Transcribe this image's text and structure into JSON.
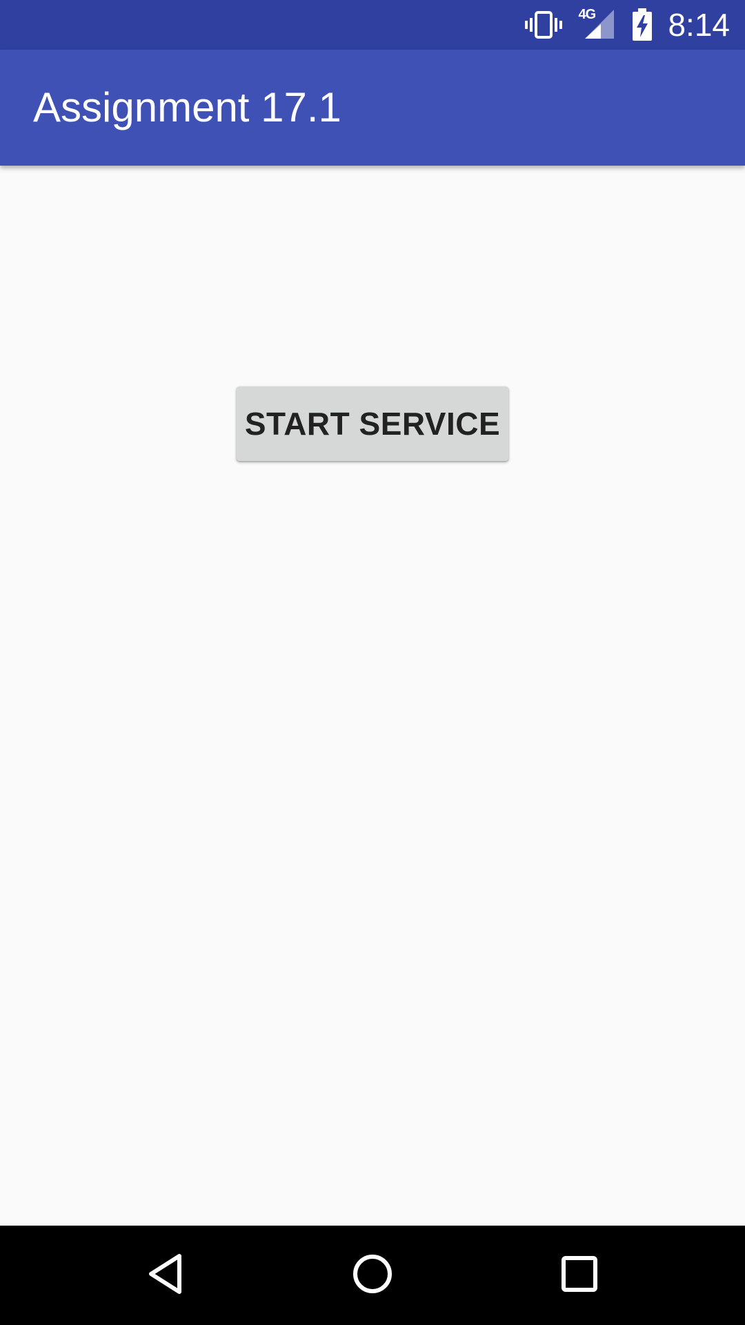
{
  "status_bar": {
    "time": "8:14",
    "network_label": "4G",
    "icons": [
      "vibrate-icon",
      "cellular-signal-icon",
      "battery-charging-icon"
    ],
    "background_color": "#3040a0"
  },
  "app_bar": {
    "title": "Assignment 17.1",
    "background_color": "#3f51b5"
  },
  "main": {
    "start_button_label": "START SERVICE"
  },
  "nav_bar": {
    "icons": [
      "back-icon",
      "home-icon",
      "recents-icon"
    ]
  }
}
